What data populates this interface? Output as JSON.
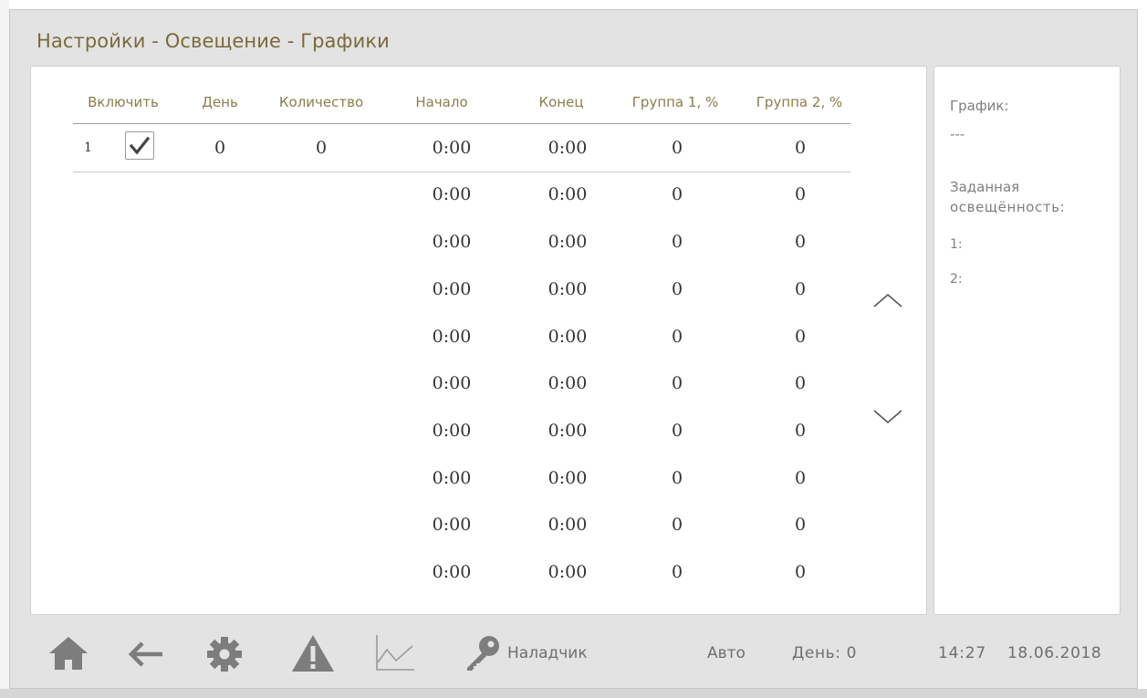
{
  "title": "Настройки - Освещение - Графики",
  "columns": [
    "Включить",
    "День",
    "Количество",
    "Начало",
    "Конец",
    "Группа 1, %",
    "Группа 2, %"
  ],
  "first_row": {
    "number": "1",
    "enabled": true,
    "day": "0",
    "count": "0"
  },
  "schedule_rows": [
    {
      "start": "0:00",
      "end": "0:00",
      "group1": "0",
      "group2": "0"
    },
    {
      "start": "0:00",
      "end": "0:00",
      "group1": "0",
      "group2": "0"
    },
    {
      "start": "0:00",
      "end": "0:00",
      "group1": "0",
      "group2": "0"
    },
    {
      "start": "0:00",
      "end": "0:00",
      "group1": "0",
      "group2": "0"
    },
    {
      "start": "0:00",
      "end": "0:00",
      "group1": "0",
      "group2": "0"
    },
    {
      "start": "0:00",
      "end": "0:00",
      "group1": "0",
      "group2": "0"
    },
    {
      "start": "0:00",
      "end": "0:00",
      "group1": "0",
      "group2": "0"
    },
    {
      "start": "0:00",
      "end": "0:00",
      "group1": "0",
      "group2": "0"
    },
    {
      "start": "0:00",
      "end": "0:00",
      "group1": "0",
      "group2": "0"
    },
    {
      "start": "0:00",
      "end": "0:00",
      "group1": "0",
      "group2": "0"
    }
  ],
  "side": {
    "schedule_label": "График:",
    "schedule_value": "---",
    "illum_label_1": "Заданная",
    "illum_label_2": "освещённость:",
    "g1_label": "1:",
    "g2_label": "2:"
  },
  "toolbar": {
    "icons": [
      "home-icon",
      "back-arrow-icon",
      "settings-gear-icon",
      "alarm-warning-icon",
      "chart-icon",
      "key-icon"
    ],
    "user_label": "Наладчик",
    "mode_label": "Авто",
    "day_label": "День: 0",
    "time": "14:27",
    "date": "18.06.2018"
  },
  "colors": {
    "title": "#7a6a3a",
    "column_header": "#8b7d4b",
    "icon": "#7d7d7d",
    "background": "#e3e3e3"
  }
}
